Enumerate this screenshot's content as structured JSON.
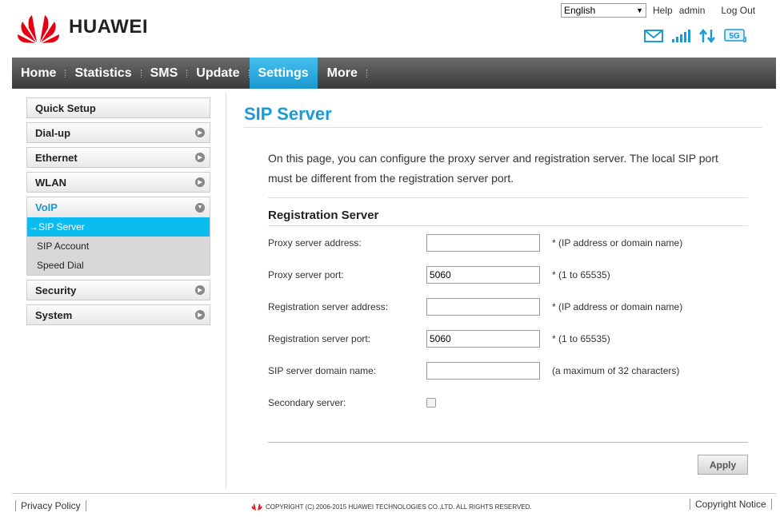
{
  "header": {
    "brand": "HUAWEI",
    "language": "English",
    "help": "Help",
    "user": "admin",
    "logout": "Log Out",
    "status_icons": [
      "mail-icon",
      "signal-icon",
      "data-transfer-icon",
      "5g-icon"
    ]
  },
  "nav": {
    "items": [
      {
        "label": "Home"
      },
      {
        "label": "Statistics"
      },
      {
        "label": "SMS"
      },
      {
        "label": "Update"
      },
      {
        "label": "Settings"
      },
      {
        "label": "More"
      }
    ],
    "active": "Settings"
  },
  "sidebar": {
    "quick_setup": "Quick Setup",
    "dialup": "Dial-up",
    "ethernet": "Ethernet",
    "wlan": "WLAN",
    "voip": "VoIP",
    "voip_sub": [
      "SIP Server",
      "SIP Account",
      "Speed Dial"
    ],
    "security": "Security",
    "system": "System"
  },
  "main": {
    "title": "SIP Server",
    "intro": "On this page, you can configure the proxy server and registration server. The local SIP port must be different from the registration server port.",
    "section_title": "Registration Server",
    "fields": {
      "proxy_address": {
        "label": "Proxy server address:",
        "value": "",
        "hint": "* (IP address or domain name)"
      },
      "proxy_port": {
        "label": "Proxy server port:",
        "value": "5060",
        "hint": "* (1 to 65535)"
      },
      "reg_address": {
        "label": "Registration server address:",
        "value": "",
        "hint": "* (IP address or domain name)"
      },
      "reg_port": {
        "label": "Registration server port:",
        "value": "5060",
        "hint": "* (1 to 65535)"
      },
      "domain": {
        "label": "SIP server domain name:",
        "value": "",
        "hint": "(a maximum of 32 characters)"
      },
      "secondary": {
        "label": "Secondary server:"
      }
    },
    "apply": "Apply"
  },
  "footer": {
    "privacy": "Privacy Policy",
    "copyright": "COPYRIGHT (C) 2006-2015 HUAWEI TECHNOLOGIES CO.,LTD. ALL RIGHTS RESERVED.",
    "notice": "Copyright Notice"
  },
  "colors": {
    "accent": "#1a9ad6",
    "active_sub": "#0bbcf0",
    "brand_red": "#e60012"
  }
}
